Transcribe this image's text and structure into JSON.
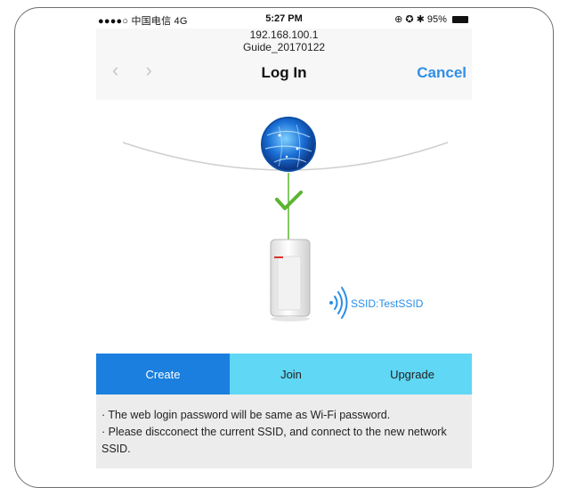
{
  "status_bar": {
    "carrier": "●●●●○ 中国电信  4G",
    "time": "5:27 PM",
    "right": "⊕ ✪ ✱ 95%"
  },
  "header": {
    "address_line1": "192.168.100.1",
    "address_line2": "Guide_20170122",
    "title": "Log In",
    "cancel_label": "Cancel",
    "back_icon": "chevron-left-icon",
    "forward_icon": "chevron-right-icon"
  },
  "illustration": {
    "ssid_label": "SSID:TestSSID",
    "check_color": "#5cb531",
    "globe_color": "#1a6fd6"
  },
  "tabs": [
    {
      "label": "Create",
      "active": true
    },
    {
      "label": "Join",
      "active": false
    },
    {
      "label": "Upgrade",
      "active": false
    }
  ],
  "notes": [
    "· The web login password will be same as Wi-Fi password.",
    "· Please discconect the current SSID, and connect to the new network SSID."
  ],
  "colors": {
    "accent": "#1a7fde",
    "tab_inactive": "#5fd7f5",
    "link": "#2f8ee7"
  }
}
